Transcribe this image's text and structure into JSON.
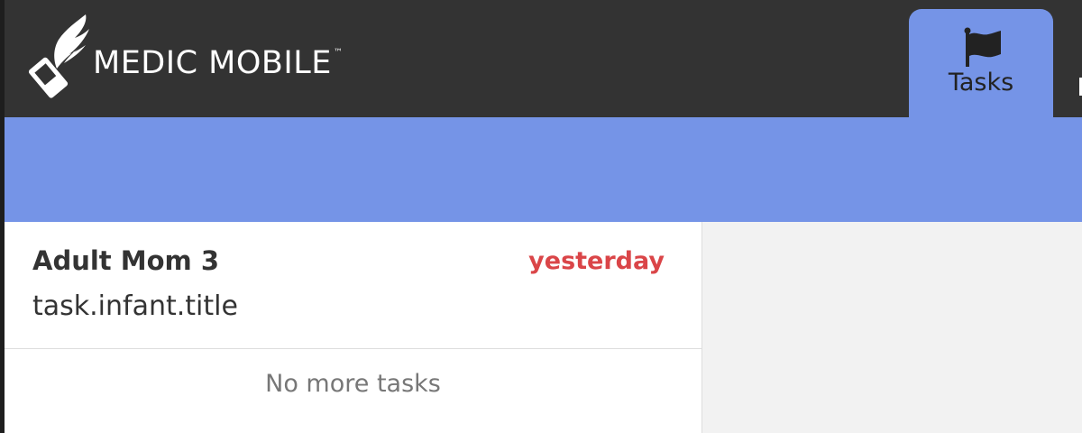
{
  "header": {
    "brand_name": "MEDIC MOBILE",
    "brand_mark": "™",
    "logo_icon": "winged-phone-logo-icon"
  },
  "nav": {
    "tabs": [
      {
        "label": "Tasks",
        "icon": "flag-icon",
        "active": true
      }
    ]
  },
  "tasks": {
    "items": [
      {
        "name": "Adult Mom 3",
        "due": "yesterday",
        "title": "task.infant.title"
      }
    ],
    "footer": "No more tasks"
  },
  "colors": {
    "header_bg": "#333333",
    "accent": "#7594e7",
    "overdue": "#da4548",
    "content_bg": "#f2f2f2"
  }
}
